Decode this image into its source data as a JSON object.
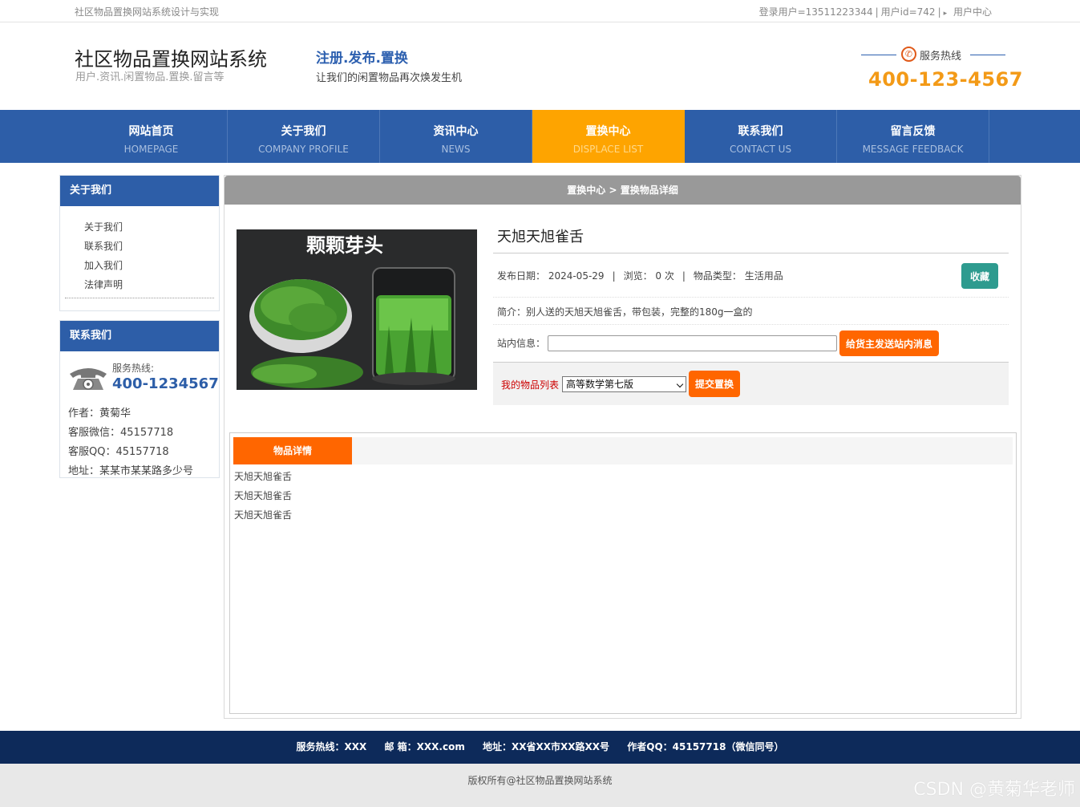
{
  "topbar": {
    "site_note": "社区物品置换网站系统设计与实现",
    "login_user": "登录用户=13511223344",
    "user_id": "用户id=742",
    "user_center": "用户中心"
  },
  "header": {
    "title": "社区物品置换网站系统",
    "subtitle": "用户.资讯.闲置物品.置换.留言等",
    "slogan": "注册.发布.置换",
    "slogan_sub": "让我们的闲置物品再次焕发生机",
    "hotline_label": "服务热线",
    "hotline_number": "400-123-4567"
  },
  "nav": {
    "items": [
      {
        "cn": "网站首页",
        "en": "HOMEPAGE"
      },
      {
        "cn": "关于我们",
        "en": "COMPANY PROFILE"
      },
      {
        "cn": "资讯中心",
        "en": "NEWS"
      },
      {
        "cn": "置换中心",
        "en": "DISPLACE LIST"
      },
      {
        "cn": "联系我们",
        "en": "CONTACT US"
      },
      {
        "cn": "留言反馈",
        "en": "MESSAGE FEEDBACK"
      }
    ],
    "active_index": 3
  },
  "sidebar": {
    "about_title": "关于我们",
    "about_items": [
      "关于我们",
      "联系我们",
      "加入我们",
      "法律声明"
    ],
    "contact_title": "联系我们",
    "service_label": "服务热线:",
    "service_number": "400-1234567",
    "author": "作者：黄菊华",
    "wechat": "客服微信：45157718",
    "qq": "客服QQ：45157718",
    "address": "地址：某某市某某路多少号"
  },
  "main": {
    "breadcrumb": "置换中心 > 置换物品详细",
    "image_text": "颗颗芽头",
    "product_title": "天旭天旭雀舌",
    "publish_date": "发布日期：  2024-05-29",
    "views": "浏览：  0 次",
    "category": "物品类型：  生活用品",
    "favorite_button": "收藏",
    "intro": "简介：别人送的天旭天旭雀舌，带包装，完整的180g一盒的",
    "message_label": "站内信息：",
    "message_value": "",
    "message_button": "给货主发送站内消息",
    "my_items_label": "我的物品列表",
    "my_items_selected": "高等数学第七版",
    "swap_button": "提交置换",
    "detail_tab": "物品详情",
    "detail_lines": [
      "天旭天旭雀舌",
      "天旭天旭雀舌",
      "天旭天旭雀舌"
    ]
  },
  "footer": {
    "hotline": "服务热线：XXX",
    "email": "邮 箱：XXX.com",
    "address": "地址：XX省XX市XX路XX号",
    "author_qq": "作者QQ：45157718（微信同号）",
    "copyright": "版权所有@社区物品置换网站系统",
    "watermark": "CSDN @黄菊华老师"
  },
  "colors": {
    "nav_blue": "#2d5ea8",
    "active_orange": "#fea400",
    "button_orange": "#ff6600",
    "favorite_teal": "#2e9b8f",
    "hotline_orange": "#f39a17",
    "footer_navy": "#0d2a5a"
  }
}
